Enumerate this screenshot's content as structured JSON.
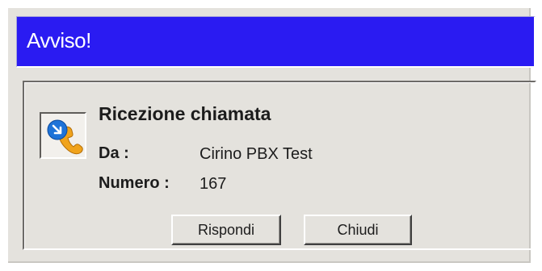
{
  "window": {
    "title": "Avviso!",
    "accent_color": "#2a1bf2"
  },
  "call": {
    "icon": "incoming-call-icon",
    "heading": "Ricezione chiamata",
    "from_label": "Da :",
    "from_value": "Cirino PBX Test",
    "number_label": "Numero :",
    "number_value": "167"
  },
  "buttons": {
    "answer_label": "Rispondi",
    "close_label": "Chiudi"
  }
}
